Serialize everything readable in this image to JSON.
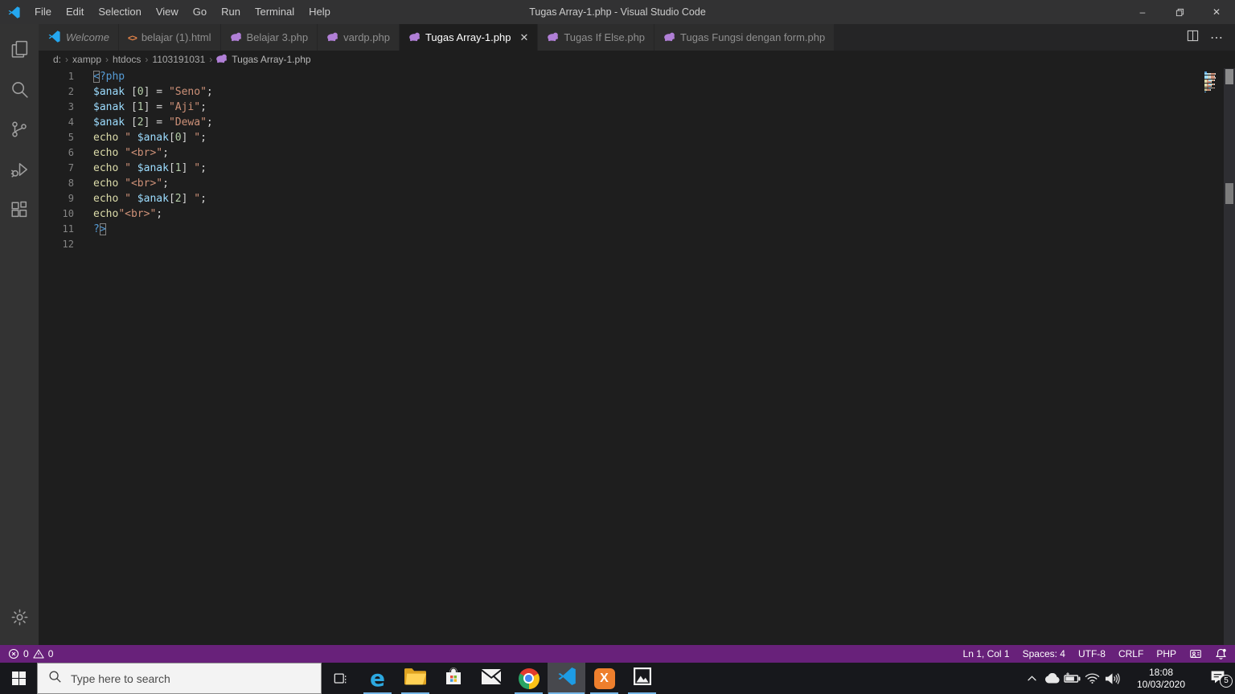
{
  "colors": {
    "statusbar": "#68217a",
    "taskbar_underline": "#75b6e7",
    "tokens": {
      "tag": "#569cd6",
      "var": "#9cdcfe",
      "num": "#b5cea8",
      "str": "#ce9178",
      "pl": "#d4d4d4",
      "fn": "#dcdcaa"
    }
  },
  "glyphs": {
    "close": "✕",
    "breadcrumb_sep": "›",
    "more": "⋯",
    "minimize": "–"
  },
  "title_bar": {
    "title": "Tugas Array-1.php - Visual Studio Code",
    "menus": [
      "File",
      "Edit",
      "Selection",
      "View",
      "Go",
      "Run",
      "Terminal",
      "Help"
    ]
  },
  "activity_bar": {
    "items": [
      {
        "icon": "explorer-icon"
      },
      {
        "icon": "search-icon"
      },
      {
        "icon": "source-control-icon"
      },
      {
        "icon": "run-debug-icon"
      },
      {
        "icon": "extensions-icon"
      }
    ],
    "bottom": [
      {
        "icon": "manage-gear-icon"
      }
    ]
  },
  "tab_bar": {
    "tabs": [
      {
        "label": "Welcome",
        "icon": "vscode-logo-icon",
        "italic": true
      },
      {
        "label": "belajar (1).html",
        "icon": "html-icon"
      },
      {
        "label": "Belajar 3.php",
        "icon": "php-icon"
      },
      {
        "label": "vardp.php",
        "icon": "php-icon"
      },
      {
        "label": "Tugas Array-1.php",
        "icon": "php-icon",
        "active": true,
        "close": true
      },
      {
        "label": "Tugas If Else.php",
        "icon": "php-icon"
      },
      {
        "label": "Tugas Fungsi dengan form.php",
        "icon": "php-icon"
      }
    ]
  },
  "breadcrumb": {
    "items": [
      "d:",
      "xampp",
      "htdocs",
      "1103191031"
    ],
    "file": "Tugas Array-1.php",
    "file_icon": "php-icon"
  },
  "editor": {
    "lines": [
      {
        "n": "1",
        "t": [
          [
            "<",
            "tag",
            "cursorbox"
          ],
          [
            "?php",
            "tag"
          ]
        ]
      },
      {
        "n": "2",
        "t": [
          [
            "$anak",
            "var"
          ],
          [
            " [",
            "pl"
          ],
          [
            "0",
            "num"
          ],
          [
            "] ",
            "pl"
          ],
          [
            "= ",
            "pl"
          ],
          [
            "\"Seno\"",
            "str"
          ],
          [
            ";",
            "pl"
          ]
        ]
      },
      {
        "n": "3",
        "t": [
          [
            "$anak",
            "var"
          ],
          [
            " [",
            "pl"
          ],
          [
            "1",
            "num"
          ],
          [
            "] ",
            "pl"
          ],
          [
            "= ",
            "pl"
          ],
          [
            "\"Aji\"",
            "str"
          ],
          [
            ";",
            "pl"
          ]
        ]
      },
      {
        "n": "4",
        "t": [
          [
            "$anak",
            "var"
          ],
          [
            " [",
            "pl"
          ],
          [
            "2",
            "num"
          ],
          [
            "] ",
            "pl"
          ],
          [
            "= ",
            "pl"
          ],
          [
            "\"Dewa\"",
            "str"
          ],
          [
            ";",
            "pl"
          ]
        ]
      },
      {
        "n": "5",
        "t": [
          [
            "echo",
            "fn"
          ],
          [
            " ",
            "pl"
          ],
          [
            "\" ",
            "str"
          ],
          [
            "$anak",
            "var"
          ],
          [
            "[",
            "pl"
          ],
          [
            "0",
            "num"
          ],
          [
            "]",
            "pl"
          ],
          [
            " \"",
            "str"
          ],
          [
            ";",
            "pl"
          ]
        ]
      },
      {
        "n": "6",
        "t": [
          [
            "echo",
            "fn"
          ],
          [
            " ",
            "pl"
          ],
          [
            "\"<br>\"",
            "str"
          ],
          [
            ";",
            "pl"
          ]
        ]
      },
      {
        "n": "7",
        "t": [
          [
            "echo",
            "fn"
          ],
          [
            " ",
            "pl"
          ],
          [
            "\" ",
            "str"
          ],
          [
            "$anak",
            "var"
          ],
          [
            "[",
            "pl"
          ],
          [
            "1",
            "num"
          ],
          [
            "]",
            "pl"
          ],
          [
            " \"",
            "str"
          ],
          [
            ";",
            "pl"
          ]
        ]
      },
      {
        "n": "8",
        "t": [
          [
            "echo",
            "fn"
          ],
          [
            " ",
            "pl"
          ],
          [
            "\"<br>\"",
            "str"
          ],
          [
            ";",
            "pl"
          ]
        ]
      },
      {
        "n": "9",
        "t": [
          [
            "echo",
            "fn"
          ],
          [
            " ",
            "pl"
          ],
          [
            "\" ",
            "str"
          ],
          [
            "$anak",
            "var"
          ],
          [
            "[",
            "pl"
          ],
          [
            "2",
            "num"
          ],
          [
            "]",
            "pl"
          ],
          [
            " \"",
            "str"
          ],
          [
            ";",
            "pl"
          ]
        ]
      },
      {
        "n": "10",
        "t": [
          [
            "echo",
            "fn"
          ],
          [
            "\"<br>\"",
            "str"
          ],
          [
            ";",
            "pl"
          ]
        ]
      },
      {
        "n": "11",
        "t": [
          [
            "?",
            "tag"
          ],
          [
            ">",
            "tag",
            "box"
          ]
        ]
      },
      {
        "n": "12",
        "t": []
      }
    ]
  },
  "status_bar": {
    "errors": "0",
    "warnings": "0",
    "cursor_position": "Ln 1, Col 1",
    "indentation": "Spaces: 4",
    "encoding": "UTF-8",
    "eol": "CRLF",
    "language": "PHP"
  },
  "taskbar": {
    "search_placeholder": "Type here to search",
    "apps": [
      {
        "name": "edge",
        "icon": "edge-icon",
        "running": true
      },
      {
        "name": "file-explorer",
        "icon": "file-explorer-icon",
        "running": true
      },
      {
        "name": "microsoft-store",
        "icon": "store-icon",
        "running": false
      },
      {
        "name": "mail",
        "icon": "mail-icon",
        "running": false
      },
      {
        "name": "chrome",
        "icon": "chrome-icon",
        "running": true
      },
      {
        "name": "vscode",
        "icon": "vscode-icon",
        "running": true,
        "active": true
      },
      {
        "name": "xampp",
        "icon": "xampp-icon",
        "running": true
      },
      {
        "name": "photos",
        "icon": "photos-icon",
        "running": true
      }
    ],
    "tray_icons": [
      "chevron-up-icon",
      "onedrive-icon",
      "battery-icon",
      "wifi-icon",
      "volume-icon"
    ],
    "clock_time": "18:08",
    "clock_date": "10/03/2020",
    "notification_badge": "5"
  }
}
